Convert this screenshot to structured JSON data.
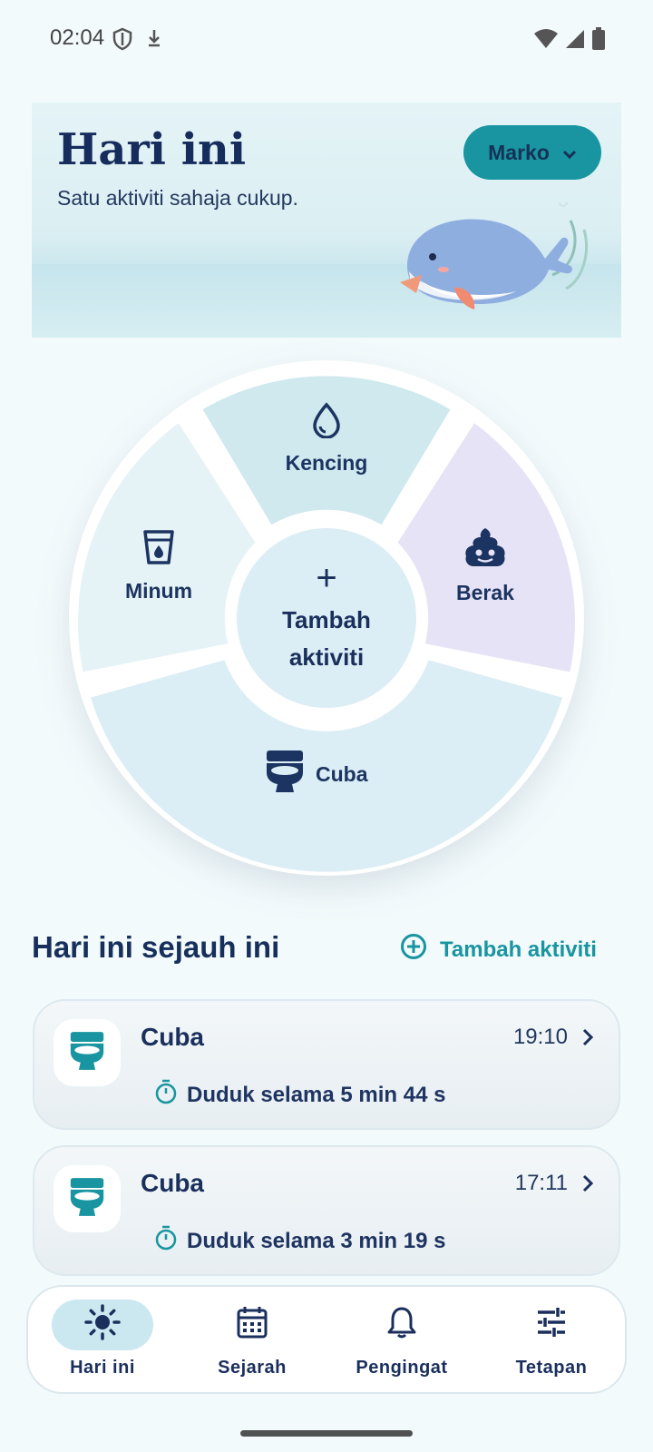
{
  "status_bar": {
    "time": "02:04"
  },
  "hero": {
    "title": "Hari ini",
    "subtitle": "Satu aktiviti sahaja cukup.",
    "profile_name": "Marko"
  },
  "wheel": {
    "segments": {
      "top": {
        "label": "Kencing",
        "icon": "droplet-icon",
        "color": "#cfe9ef"
      },
      "left": {
        "label": "Minum",
        "icon": "water-glass-icon",
        "color": "#e6f3f6"
      },
      "right": {
        "label": "Berak",
        "icon": "poop-icon",
        "color": "#e6e3f6"
      },
      "bottom": {
        "label": "Cuba",
        "icon": "toilet-icon",
        "color": "#dbedf5"
      }
    },
    "center": {
      "plus": "+",
      "label": "Tambah aktiviti"
    }
  },
  "today": {
    "title": "Hari ini sejauh ini",
    "add_label": "Tambah aktiviti"
  },
  "entries": [
    {
      "title": "Cuba",
      "time": "19:10",
      "detail": "Duduk selama 5 min 44 s",
      "icon": "toilet-icon"
    },
    {
      "title": "Cuba",
      "time": "17:11",
      "detail": "Duduk selama 3 min 19 s",
      "icon": "toilet-icon"
    }
  ],
  "nav": {
    "items": [
      {
        "label": "Hari ini",
        "icon": "sun-icon",
        "active": true
      },
      {
        "label": "Sejarah",
        "icon": "calendar-icon",
        "active": false
      },
      {
        "label": "Pengingat",
        "icon": "bell-icon",
        "active": false
      },
      {
        "label": "Tetapan",
        "icon": "sliders-icon",
        "active": false
      }
    ]
  },
  "colors": {
    "accent": "#1895a0",
    "navy": "#1a2f5c",
    "background": "#f3fafc"
  }
}
